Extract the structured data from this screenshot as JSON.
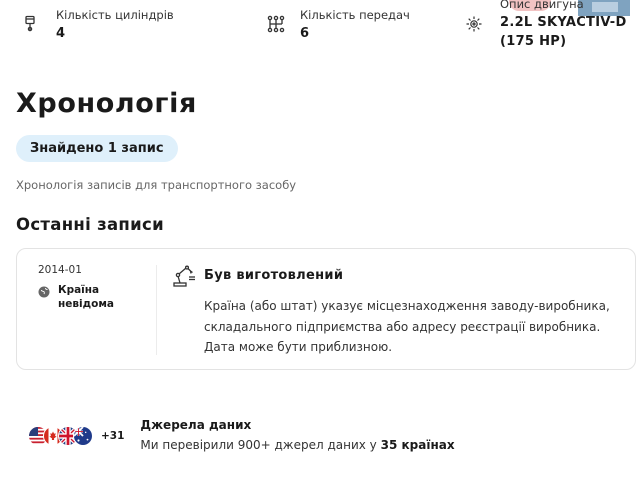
{
  "specs": {
    "cylinders": {
      "label": "Кількість циліндрів",
      "value": "4",
      "icon": "cylinder-icon"
    },
    "gears": {
      "label": "Кількість передач",
      "value": "6",
      "icon": "gearbox-icon"
    },
    "engine": {
      "label": "Опис двигуна",
      "value_line1": "2.2L SKYACTIV-D",
      "value_line2": "(175 HP)",
      "icon": "engine-icon"
    }
  },
  "timeline": {
    "title": "Хронологія",
    "badge": "Знайдено 1 запис",
    "subtitle": "Хронологія записів для транспортного засобу",
    "recent_title": "Останні записи",
    "records": [
      {
        "date": "2014-01",
        "country_line1": "Країна",
        "country_line2": "невідома",
        "event_title": "Був виготовлений",
        "description": "Країна (або штат) указує місцезнаходження заводу-виробника, складального підприємства або адресу реєстрації виробника. Дата може бути приблизною.",
        "icon": "factory-robot-arm-icon"
      }
    ]
  },
  "sources": {
    "flags": [
      "us",
      "ca",
      "gb",
      "au"
    ],
    "more_count": "+31",
    "title": "Джерела даних",
    "desc_prefix": "Ми перевірили 900+ джерел даних у",
    "desc_bold": "35 країнах"
  },
  "colors": {
    "badge_bg": "#dff0fb",
    "card_border": "#e3e3e3",
    "text": "#1a1a1a",
    "muted": "#666666"
  }
}
